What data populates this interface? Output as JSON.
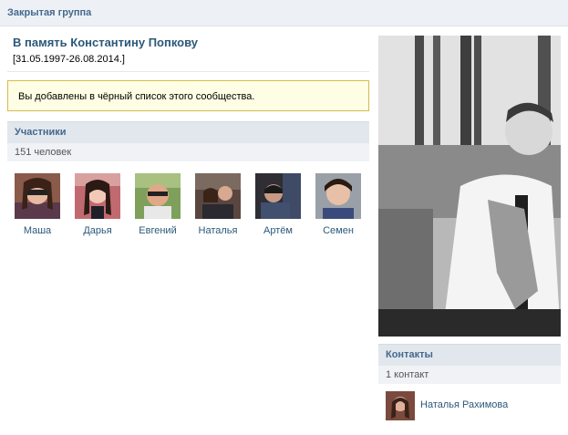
{
  "header": {
    "title": "Закрытая группа"
  },
  "group": {
    "name": "В память Константину Попкову",
    "status": "[31.05.1997-26.08.2014.]"
  },
  "notice": {
    "text": "Вы добавлены в чёрный список этого сообщества."
  },
  "members": {
    "title": "Участники",
    "count": "151 человек",
    "items": [
      {
        "name": "Маша"
      },
      {
        "name": "Дарья"
      },
      {
        "name": "Евгений"
      },
      {
        "name": "Наталья"
      },
      {
        "name": "Артём"
      },
      {
        "name": "Семен"
      }
    ]
  },
  "contacts": {
    "title": "Контакты",
    "count": "1 контакт",
    "items": [
      {
        "name": "Наталья Рахимова"
      }
    ]
  },
  "colors": {
    "link": "#2b587a",
    "header_text": "#45688e",
    "notice_bg": "#fefee4",
    "notice_border": "#d4bc4c"
  }
}
